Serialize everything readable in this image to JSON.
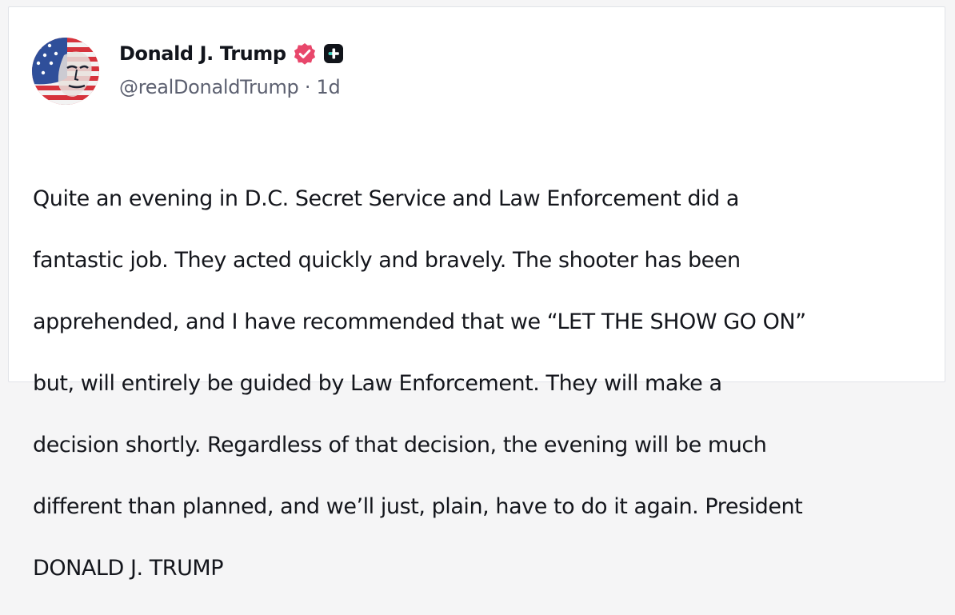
{
  "post": {
    "author": {
      "display_name": "Donald J. Trump",
      "handle": "@realDonaldTrump",
      "verified_icon": "verified-badge-icon",
      "badge_icon": "plus-badge-icon"
    },
    "separator": "·",
    "timestamp": "1d",
    "text_lines": [
      "Quite an evening in D.C. Secret Service and Law Enforcement did a",
      "fantastic job. They acted quickly and bravely. The shooter has been",
      "apprehended, and I have recommended that we “LET THE SHOW GO ON”",
      "but, will entirely be guided by Law Enforcement. They will make a",
      "decision shortly. Regardless of that decision, the evening will be much",
      "different than planned, and we’ll just, plain, have to do it again. President",
      "DONALD J. TRUMP"
    ]
  },
  "colors": {
    "verified_badge": "#e8476b",
    "plus_badge": "#11141a",
    "name": "#12151c",
    "meta": "#5c6070",
    "body": "#14161c"
  }
}
